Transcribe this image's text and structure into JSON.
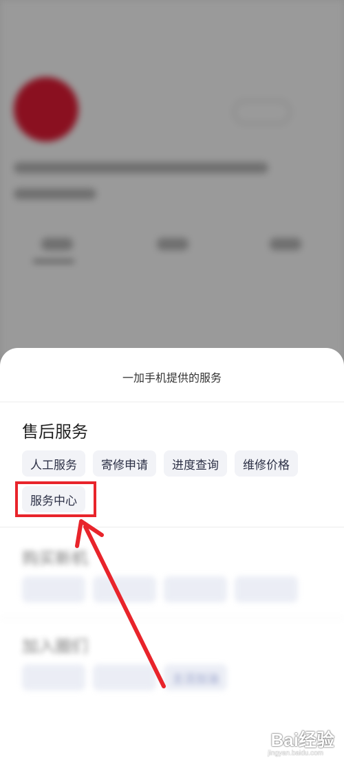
{
  "sheet": {
    "title": "一加手机提供的服务"
  },
  "after_sales": {
    "title": "售后服务",
    "chips": [
      "人工服务",
      "寄修申请",
      "进度查询",
      "维修价格",
      "服务中心"
    ]
  },
  "buy_phone": {
    "title": "购买新机"
  },
  "join_community": {
    "title": "加入圈们",
    "chip_3": "主活加油"
  },
  "watermark": {
    "logo": "Bai经验",
    "url": "jingyan.baidu.com"
  },
  "colors": {
    "highlight": "#e8242b",
    "chip_bg": "#f2f3f7",
    "avatar": "#8a1020"
  }
}
